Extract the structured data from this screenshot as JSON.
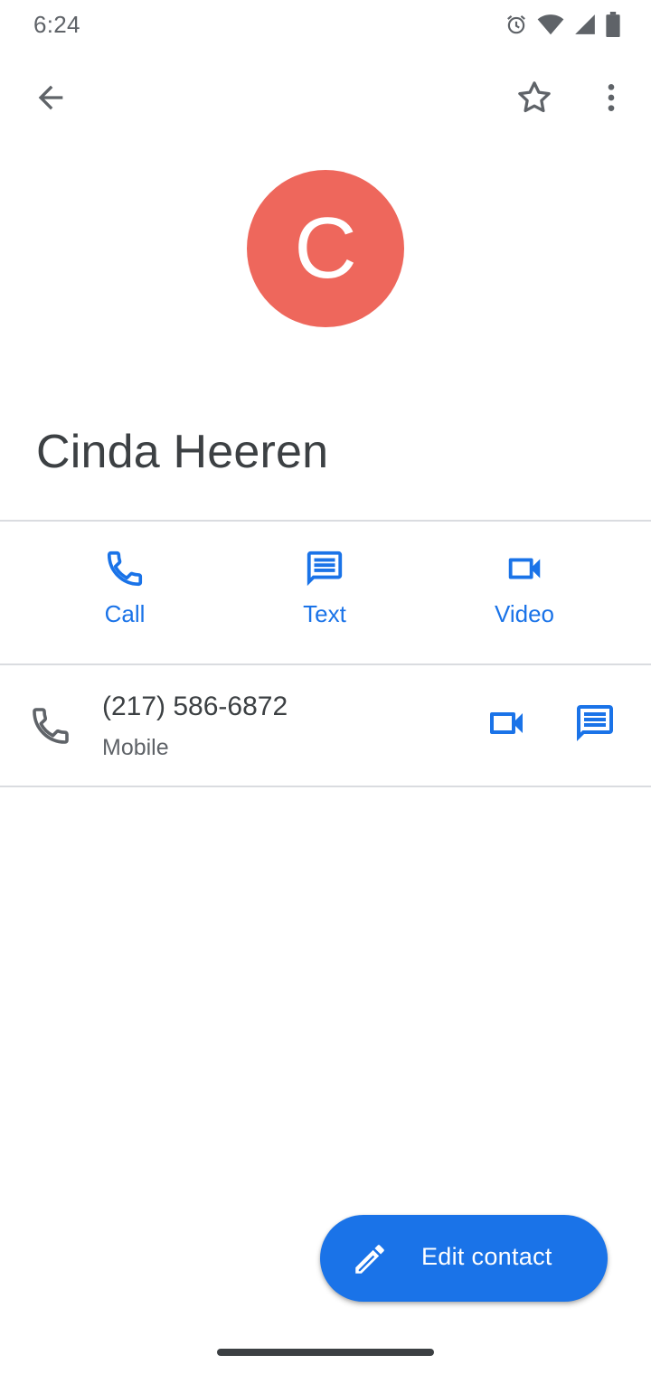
{
  "status_bar": {
    "time": "6:24",
    "icons": [
      "alarm-icon",
      "wifi-icon",
      "signal-icon",
      "battery-icon"
    ]
  },
  "app_bar": {
    "icons": [
      "arrow-back-icon",
      "star-outline-icon",
      "more-vert-icon"
    ]
  },
  "contact": {
    "initial": "C",
    "name": "Cinda Heeren",
    "avatar_color": "#ee675c"
  },
  "actions": [
    {
      "label": "Call",
      "icon": "phone-icon"
    },
    {
      "label": "Text",
      "icon": "message-icon"
    },
    {
      "label": "Video",
      "icon": "videocam-icon"
    }
  ],
  "phone_entry": {
    "number": "(217) 586-6872",
    "type": "Mobile",
    "icons": [
      "phone-icon",
      "videocam-icon",
      "message-icon"
    ]
  },
  "fab": {
    "label": "Edit contact",
    "icon": "pencil-icon"
  },
  "colors": {
    "accent": "#1a73e8",
    "text_primary": "#3c4043",
    "text_secondary": "#5f6368",
    "divider": "#dadce0"
  }
}
